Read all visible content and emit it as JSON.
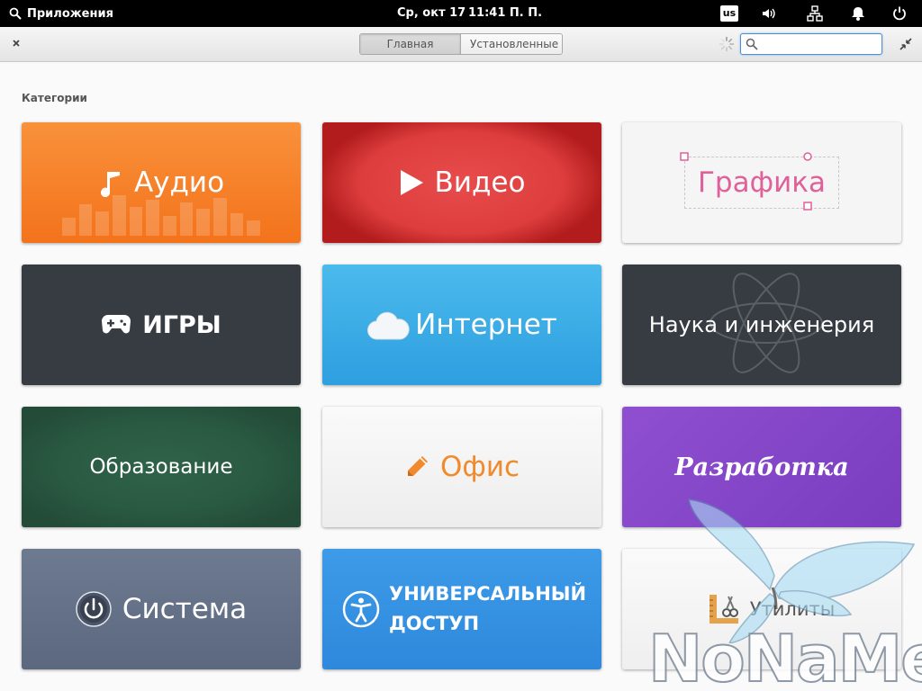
{
  "panel": {
    "apps_label": "Приложения",
    "date": "Ср, окт 17",
    "time": "11:41 П. П.",
    "keyboard_layout": "us"
  },
  "header": {
    "mode_main": "Главная",
    "mode_installed": "Установленные",
    "search_value": "",
    "search_placeholder": ""
  },
  "content": {
    "section_title": "Категории",
    "categories": [
      {
        "label": "Аудио",
        "icon": "music-note-icon"
      },
      {
        "label": "Видео",
        "icon": "play-icon"
      },
      {
        "label": "Графика",
        "icon": "selection-frame-icon"
      },
      {
        "label": "ИГРЫ",
        "icon": "gamepad-icon"
      },
      {
        "label": "Интернет",
        "icon": "cloud-icon"
      },
      {
        "label": "Наука и инженерия",
        "icon": "atom-icon"
      },
      {
        "label": "Образование",
        "icon": ""
      },
      {
        "label": "Офис",
        "icon": "pencil-icon"
      },
      {
        "label": "Разработка",
        "icon": ""
      },
      {
        "label": "Система",
        "icon": "power-icon"
      },
      {
        "label": "УНИВЕРСАЛЬНЫЙ ДОСТУП",
        "line1": "УНИВЕРСАЛЬНЫЙ",
        "line2": "ДОСТУП",
        "icon": "accessibility-icon"
      },
      {
        "label": "Утилиты",
        "icon": "utilities-icon"
      }
    ]
  },
  "watermark": "NoNaMe",
  "colors": {
    "audio": "#f3731b",
    "video": "#dd3d3d",
    "graphics_accent": "#e0609a",
    "dark": "#363c42",
    "internet": "#2e9fe0",
    "education": "#2a5a42",
    "office_accent": "#f08a2c",
    "development": "#7a3dc0",
    "system": "#5c687f",
    "accessibility": "#2e88dc"
  }
}
